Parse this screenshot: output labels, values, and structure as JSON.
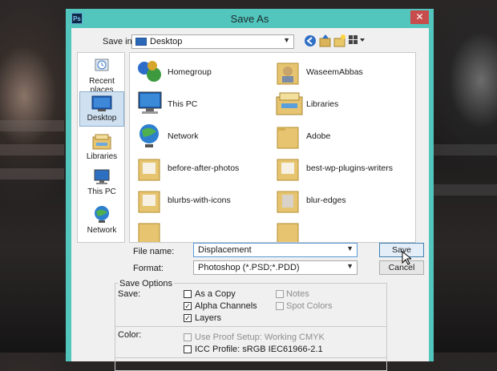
{
  "window": {
    "title": "Save As",
    "app_icon": "Ps",
    "close": "✕"
  },
  "toolbar": {
    "save_in_label": "Save in:",
    "save_in_value": "Desktop"
  },
  "places": [
    {
      "label": "Recent places",
      "icon": "recent-places-icon"
    },
    {
      "label": "Desktop",
      "icon": "desktop-icon",
      "active": true
    },
    {
      "label": "Libraries",
      "icon": "libraries-icon"
    },
    {
      "label": "This PC",
      "icon": "this-pc-icon"
    },
    {
      "label": "Network",
      "icon": "network-icon"
    }
  ],
  "files": [
    {
      "name": "Homegroup",
      "icon": "homegroup-icon"
    },
    {
      "name": "WaseemAbbas",
      "icon": "user-folder-icon"
    },
    {
      "name": "This PC",
      "icon": "this-pc-icon"
    },
    {
      "name": "Libraries",
      "icon": "libraries-icon"
    },
    {
      "name": "Network",
      "icon": "network-icon"
    },
    {
      "name": "Adobe",
      "icon": "folder-icon"
    },
    {
      "name": "before-after-photos",
      "icon": "folder-icon"
    },
    {
      "name": "best-wp-plugins-writers",
      "icon": "folder-icon"
    },
    {
      "name": "blurbs-with-icons",
      "icon": "folder-icon"
    },
    {
      "name": "blur-edges",
      "icon": "folder-icon"
    }
  ],
  "form": {
    "filename_label": "File name:",
    "filename_value": "Displacement",
    "format_label": "Format:",
    "format_value": "Photoshop (*.PSD;*.PDD)",
    "save_button": "Save",
    "cancel_button": "Cancel"
  },
  "options": {
    "title": "Save Options",
    "save_label": "Save:",
    "as_a_copy": {
      "label": "As a Copy",
      "checked": false,
      "enabled": true
    },
    "notes": {
      "label": "Notes",
      "checked": false,
      "enabled": false
    },
    "alpha_channels": {
      "label": "Alpha Channels",
      "checked": true,
      "enabled": true
    },
    "spot_colors": {
      "label": "Spot Colors",
      "checked": false,
      "enabled": false
    },
    "layers": {
      "label": "Layers",
      "checked": true,
      "enabled": true
    },
    "color_label": "Color:",
    "use_proof": {
      "label": "Use Proof Setup:  Working CMYK",
      "checked": false,
      "enabled": false
    },
    "icc_profile": {
      "label": "ICC Profile:  sRGB IEC61966-2.1",
      "checked": false,
      "enabled": true
    }
  },
  "colors": {
    "window_frame": "#52c5bd",
    "close_button": "#c94c4c",
    "selected_place": "#cfe0f0"
  }
}
